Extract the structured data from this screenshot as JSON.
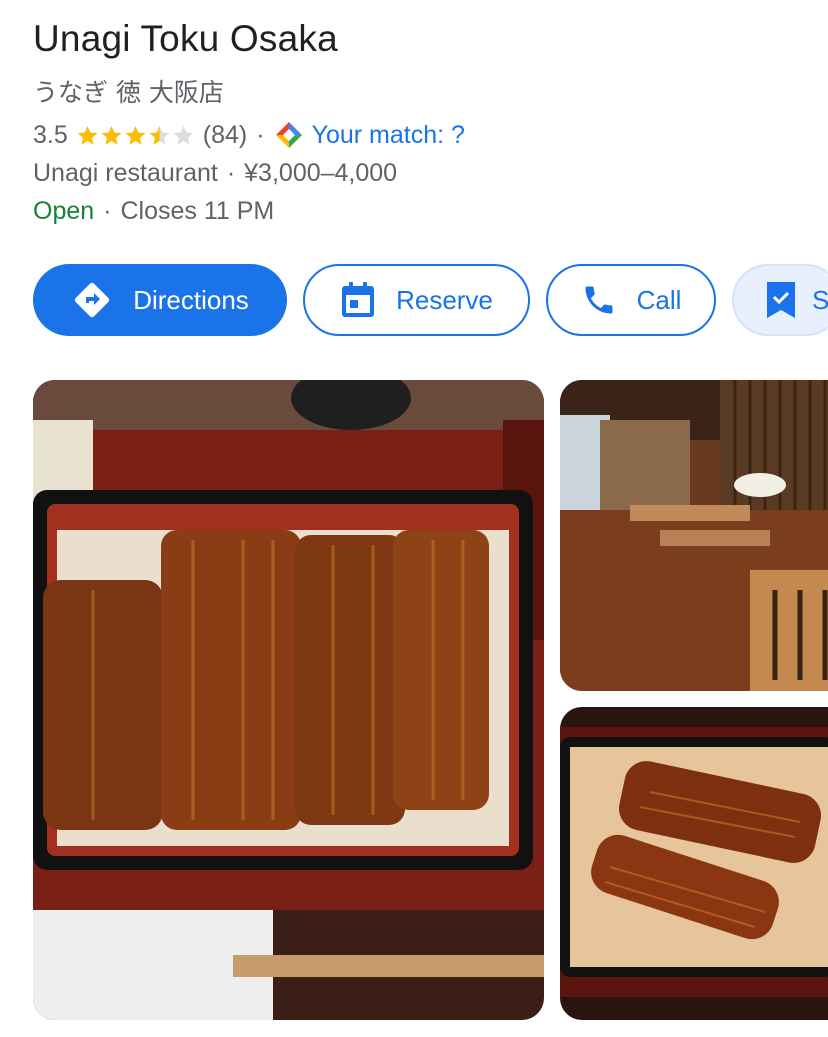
{
  "place": {
    "name": "Unagi Toku Osaka",
    "local_name": "うなぎ 徳 大阪店",
    "rating": "3.5",
    "star_value": 3.5,
    "reviews": "(84)",
    "separator": "·",
    "match_label": "Your match: ?",
    "category": "Unagi restaurant",
    "price": "¥3,000–4,000",
    "status": "Open",
    "closes": "Closes 11 PM"
  },
  "actions": {
    "directions": "Directions",
    "reserve": "Reserve",
    "call": "Call",
    "save": "S"
  },
  "colors": {
    "accent": "#1a73e8",
    "star": "#fbbc04",
    "open": "#188038",
    "secondary_text": "#5f6368"
  },
  "icons": [
    "directions-icon",
    "calendar-icon",
    "phone-icon",
    "bookmark-icon",
    "star-icon",
    "match-diamond-icon"
  ],
  "photos": [
    {
      "id": "unagi-bowl-large"
    },
    {
      "id": "restaurant-interior"
    },
    {
      "id": "unagi-bowl-small"
    }
  ]
}
